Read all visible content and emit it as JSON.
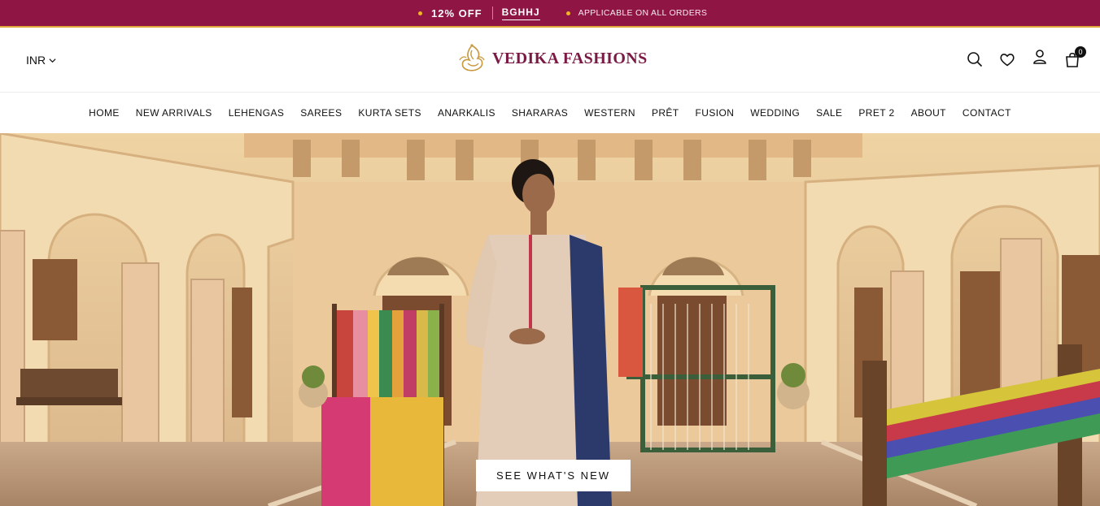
{
  "announcement": {
    "offer": "12% OFF",
    "code": "BGHHJ",
    "note": "APPLICABLE ON ALL ORDERS"
  },
  "header": {
    "currency": "INR",
    "brand": "VEDIKA FASHIONS",
    "cart_count": "0"
  },
  "icons": [
    "search-icon",
    "heart-icon",
    "user-icon",
    "cart-icon",
    "chevron-down-icon"
  ],
  "nav": {
    "items": [
      "HOME",
      "NEW ARRIVALS",
      "LEHENGAS",
      "SAREES",
      "KURTA SETS",
      "ANARKALIS",
      "SHARARAS",
      "WESTERN",
      "PRÊT",
      "FUSION",
      "WEDDING",
      "SALE",
      "PRET 2",
      "ABOUT",
      "CONTACT"
    ]
  },
  "hero": {
    "cta_label": "SEE WHAT'S NEW"
  },
  "colors": {
    "announcement_bg": "#8e1544",
    "accent_gold": "#e0a73a",
    "brand_text": "#7a1a45"
  }
}
